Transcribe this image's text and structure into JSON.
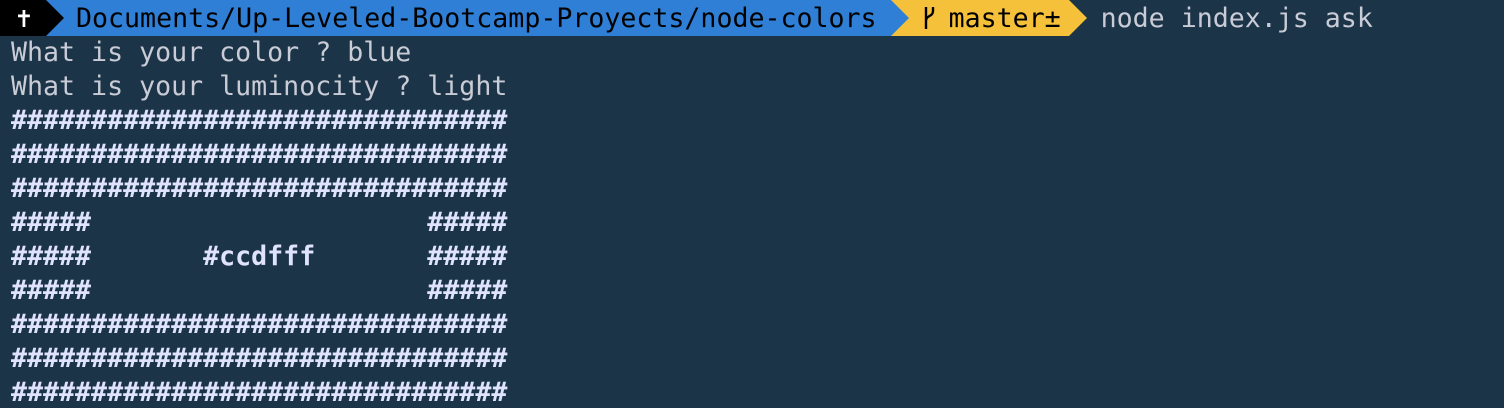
{
  "prompt": {
    "root_glyph": "✝",
    "path": "Documents/Up-Leveled-Bootcamp-Proyects/node-colors",
    "branch_icon": "git-branch-icon",
    "branch": "master±",
    "command": "node index.js ask"
  },
  "output": {
    "questions": [
      "What is your color ? blue",
      "What is your luminocity ? light"
    ],
    "box_lines": [
      "###############################",
      "###############################",
      "###############################",
      "#####                     #####",
      "#####       #ccdfff       #####",
      "#####                     #####",
      "###############################",
      "###############################",
      "###############################"
    ]
  },
  "colors": {
    "background": "#1b3448",
    "path_segment": "#2f7fd6",
    "git_segment": "#f6c13a",
    "root_segment": "#000000",
    "text": "#c9ccd6",
    "box_text": "#dfe3fb"
  }
}
